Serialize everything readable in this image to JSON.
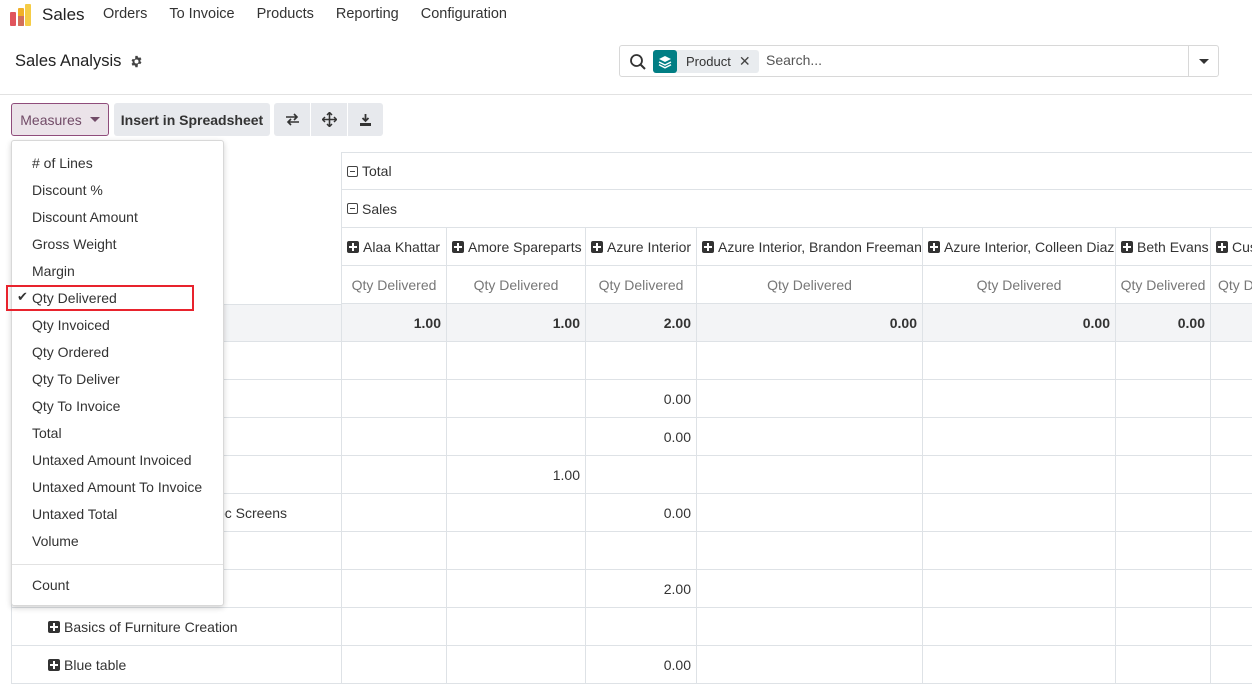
{
  "nav": {
    "brand": "Sales",
    "menu": [
      "Orders",
      "To Invoice",
      "Products",
      "Reporting",
      "Configuration"
    ]
  },
  "control_panel": {
    "title": "Sales Analysis",
    "facet_label": "Product",
    "search_placeholder": "Search..."
  },
  "toolbar": {
    "measures_label": "Measures",
    "spreadsheet_label": "Insert in Spreadsheet"
  },
  "measures_menu": {
    "items": [
      "# of Lines",
      "Discount %",
      "Discount Amount",
      "Gross Weight",
      "Margin",
      "Qty Delivered",
      "Qty Invoiced",
      "Qty Ordered",
      "Qty To Deliver",
      "Qty To Invoice",
      "Total",
      "Untaxed Amount Invoiced",
      "Untaxed Amount To Invoice",
      "Untaxed Total",
      "Volume"
    ],
    "checked_item": "Qty Delivered",
    "count_label": "Count"
  },
  "pivot": {
    "total_header": "Total",
    "group_header": "Sales",
    "columns": [
      "Alaa Khattar",
      "Amore Spareparts",
      "Azure Interior",
      "Azure Interior, Brandon Freeman",
      "Azure Interior, Colleen Diaz",
      "Beth Evans",
      "Cus"
    ],
    "measure_label": "Qty Delivered",
    "measure_label_partial": "Qty D",
    "totals": [
      "1.00",
      "1.00",
      "2.00",
      "0.00",
      "0.00",
      "0.00",
      ""
    ],
    "rows": [
      {
        "label": "",
        "values": [
          "",
          "",
          "",
          "",
          "",
          "",
          ""
        ]
      },
      {
        "label": "",
        "values": [
          "",
          "",
          "0.00",
          "",
          "",
          "",
          ""
        ]
      },
      {
        "label": "",
        "values": [
          "",
          "",
          "0.00",
          "",
          "",
          "",
          ""
        ]
      },
      {
        "label": "",
        "values": [
          "",
          "1.00",
          "",
          "",
          "",
          "",
          ""
        ]
      },
      {
        "label": "oc Screens",
        "values": [
          "",
          "",
          "0.00",
          "",
          "",
          "",
          ""
        ]
      },
      {
        "label": "",
        "values": [
          "",
          "",
          "",
          "",
          "",
          "",
          ""
        ]
      },
      {
        "label": "",
        "values": [
          "",
          "",
          "2.00",
          "",
          "",
          "",
          ""
        ]
      },
      {
        "label": "Basics of Furniture Creation",
        "values": [
          "",
          "",
          "",
          "",
          "",
          "",
          ""
        ]
      },
      {
        "label": "Blue table",
        "values": [
          "",
          "",
          "0.00",
          "",
          "",
          "",
          ""
        ]
      }
    ]
  }
}
